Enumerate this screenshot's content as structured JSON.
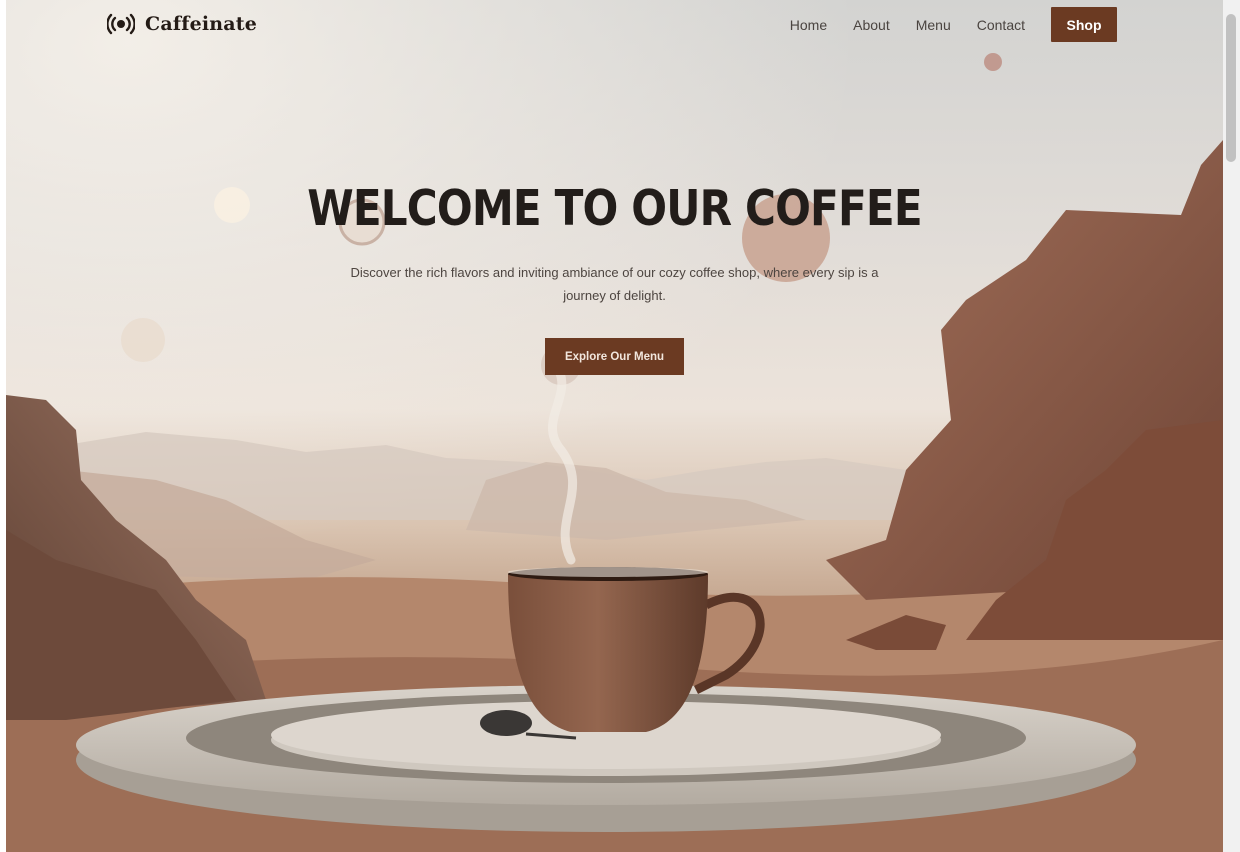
{
  "brand": {
    "name": "Caffeinate",
    "icon": "broadcast-icon"
  },
  "nav": {
    "links": [
      "Home",
      "About",
      "Menu",
      "Contact"
    ],
    "shop_label": "Shop"
  },
  "hero": {
    "title": "WELCOME TO OUR COFFEE",
    "description": "Discover the rich flavors and inviting ambiance of our cozy coffee shop, where every sip is a journey of delight.",
    "cta_label": "Explore Our Menu"
  },
  "colors": {
    "accent": "#6b3a22",
    "title": "#221d1a",
    "body_text": "#4d4540"
  }
}
